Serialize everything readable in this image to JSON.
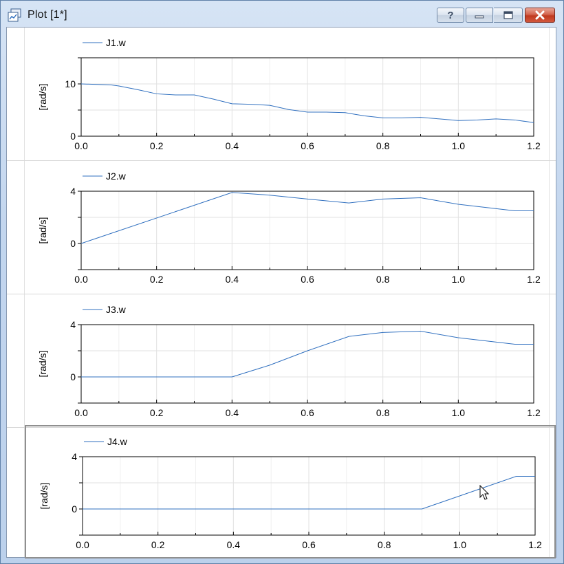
{
  "window": {
    "title": "Plot [1*]",
    "buttons": {
      "help": "?",
      "minimize": "minimize",
      "maximize": "maximize",
      "close": "close"
    },
    "icons": {
      "app": "plot-window-icon"
    }
  },
  "colors": {
    "series": "#2f6fbf",
    "grid": "#e1e1e1",
    "axis": "#000000"
  },
  "chart_data": [
    {
      "type": "line",
      "legend": "J1.w",
      "ylabel": "[rad/s]",
      "xlim": [
        0,
        1.2
      ],
      "ylim": [
        0,
        15
      ],
      "xticks": [
        "0.0",
        "0.2",
        "0.4",
        "0.6",
        "0.8",
        "1.0",
        "1.2"
      ],
      "yticks": [
        0,
        10
      ],
      "grid": true,
      "series": [
        {
          "name": "J1.w",
          "x": [
            0.0,
            0.08,
            0.1,
            0.15,
            0.2,
            0.25,
            0.3,
            0.35,
            0.4,
            0.45,
            0.5,
            0.55,
            0.6,
            0.65,
            0.7,
            0.75,
            0.8,
            0.85,
            0.9,
            0.95,
            1.0,
            1.05,
            1.1,
            1.15,
            1.2
          ],
          "y": [
            10.0,
            9.8,
            9.6,
            8.9,
            8.1,
            7.9,
            7.9,
            7.1,
            6.2,
            6.1,
            5.9,
            5.1,
            4.6,
            4.6,
            4.5,
            3.9,
            3.5,
            3.5,
            3.6,
            3.3,
            3.0,
            3.1,
            3.3,
            3.1,
            2.6
          ]
        }
      ]
    },
    {
      "type": "line",
      "legend": "J2.w",
      "ylabel": "[rad/s]",
      "xlim": [
        0,
        1.2
      ],
      "ylim": [
        -2,
        4
      ],
      "xticks": [
        "0.0",
        "0.2",
        "0.4",
        "0.6",
        "0.8",
        "1.0",
        "1.2"
      ],
      "yticks": [
        0,
        4
      ],
      "grid": true,
      "series": [
        {
          "name": "J2.w",
          "x": [
            0.0,
            0.4,
            0.5,
            0.6,
            0.71,
            0.8,
            0.9,
            1.0,
            1.15,
            1.2
          ],
          "y": [
            0.0,
            3.9,
            3.7,
            3.4,
            3.1,
            3.4,
            3.5,
            3.0,
            2.5,
            2.5
          ]
        }
      ]
    },
    {
      "type": "line",
      "legend": "J3.w",
      "ylabel": "[rad/s]",
      "xlim": [
        0,
        1.2
      ],
      "ylim": [
        -2,
        4
      ],
      "xticks": [
        "0.0",
        "0.2",
        "0.4",
        "0.6",
        "0.8",
        "1.0",
        "1.2"
      ],
      "yticks": [
        0,
        4
      ],
      "grid": true,
      "series": [
        {
          "name": "J3.w",
          "x": [
            0.0,
            0.4,
            0.5,
            0.6,
            0.71,
            0.8,
            0.9,
            1.0,
            1.15,
            1.2
          ],
          "y": [
            0.0,
            0.0,
            0.9,
            2.0,
            3.1,
            3.4,
            3.5,
            3.0,
            2.5,
            2.5
          ]
        }
      ]
    },
    {
      "type": "line",
      "legend": "J4.w",
      "ylabel": "[rad/s]",
      "xlim": [
        0,
        1.2
      ],
      "ylim": [
        -2,
        4
      ],
      "xticks": [
        "0.0",
        "0.2",
        "0.4",
        "0.6",
        "0.8",
        "1.0",
        "1.2"
      ],
      "yticks": [
        0,
        4
      ],
      "grid": true,
      "series": [
        {
          "name": "J4.w",
          "x": [
            0.0,
            0.9,
            1.15,
            1.2
          ],
          "y": [
            0.0,
            0.0,
            2.5,
            2.5
          ]
        }
      ]
    }
  ]
}
